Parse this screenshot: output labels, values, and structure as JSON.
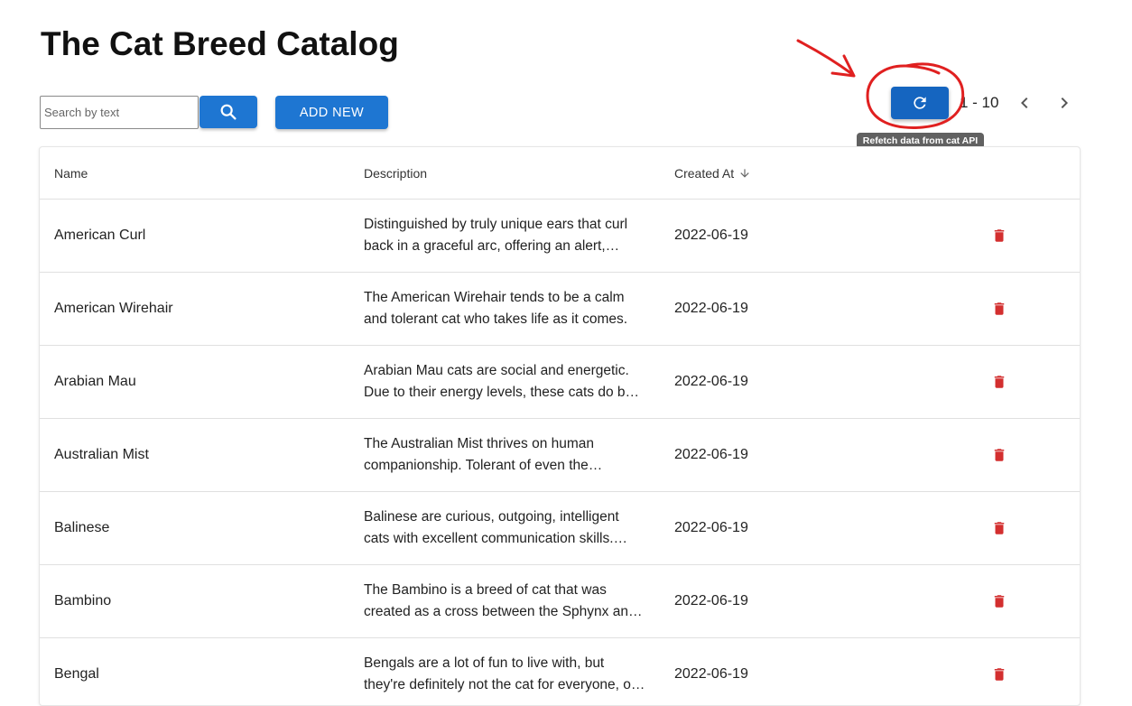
{
  "page": {
    "title": "The Cat Breed Catalog"
  },
  "toolbar": {
    "search_placeholder": "Search by text",
    "search_value": "",
    "search_icon": "search-icon",
    "add_label": "ADD NEW",
    "refresh_icon": "refresh-icon",
    "tooltip": "Refetch data from cat API"
  },
  "pagination": {
    "range": "1 - 10",
    "prev_icon": "chevron-left-icon",
    "next_icon": "chevron-right-icon"
  },
  "table": {
    "columns": [
      "Name",
      "Description",
      "Created At"
    ],
    "sort_icon": "arrow-down-icon",
    "delete_icon": "trash-icon",
    "rows": [
      {
        "name": "American Curl",
        "description": "Distinguished by truly unique ears that curl back in a graceful arc, offering an alert, curious expression.",
        "created": "2022-06-19"
      },
      {
        "name": "American Wirehair",
        "description": "The American Wirehair tends to be a calm and tolerant cat who takes life as it comes.",
        "created": "2022-06-19"
      },
      {
        "name": "Arabian Mau",
        "description": "Arabian Mau cats are social and energetic. Due to their energy levels, these cats do best in homes.",
        "created": "2022-06-19"
      },
      {
        "name": "Australian Mist",
        "description": "The Australian Mist thrives on human companionship. Tolerant of even the youngest of children.",
        "created": "2022-06-19"
      },
      {
        "name": "Balinese",
        "description": "Balinese are curious, outgoing, intelligent cats with excellent communication skills. They are known.",
        "created": "2022-06-19"
      },
      {
        "name": "Bambino",
        "description": "The Bambino is a breed of cat that was created as a cross between the Sphynx and the Munchkin breeds.",
        "created": "2022-06-19"
      },
      {
        "name": "Bengal",
        "description": "Bengals are a lot of fun to live with, but they're definitely not the cat for everyone, or for first-time cat owners.",
        "created": "2022-06-19"
      }
    ]
  },
  "colors": {
    "primary": "#1e76d2",
    "refresh": "#1565c0",
    "delete": "#d32f2f",
    "annotation": "#e02020"
  }
}
